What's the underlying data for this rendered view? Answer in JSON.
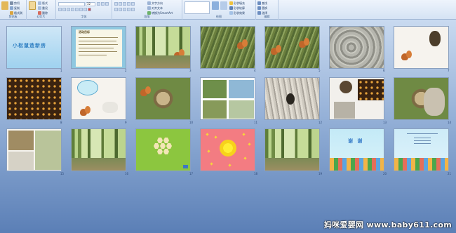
{
  "ribbon": {
    "groups": [
      {
        "id": "clipboard",
        "label": "剪贴板",
        "buttons": [
          "剪切",
          "复制",
          "格式刷"
        ],
        "paste": "粘贴"
      },
      {
        "id": "slides",
        "label": "幻灯片",
        "buttons": [
          "新建",
          "版式",
          "重设",
          "删除"
        ]
      },
      {
        "id": "font",
        "label": "字体",
        "font_size": "32"
      },
      {
        "id": "paragraph",
        "label": "段落",
        "buttons": [
          "文字方向",
          "对齐文本",
          "转换为SmartArt"
        ]
      },
      {
        "id": "drawing",
        "label": "绘图",
        "buttons": [
          "形状填充",
          "形状轮廓",
          "形状效果",
          "排列",
          "快速样式"
        ]
      },
      {
        "id": "editing",
        "label": "编辑",
        "buttons": [
          "查找",
          "替换",
          "选择"
        ]
      }
    ]
  },
  "slides": [
    {
      "n": "1",
      "kind": "title",
      "title": "小松鼠造新房"
    },
    {
      "n": "2",
      "kind": "objectives",
      "heading": "活动目标"
    },
    {
      "n": "3",
      "kind": "forest"
    },
    {
      "n": "4",
      "kind": "squirrel-tree"
    },
    {
      "n": "5",
      "kind": "squirrels-grass"
    },
    {
      "n": "6",
      "kind": "stone-faces"
    },
    {
      "n": "7",
      "kind": "squirrel-nest"
    },
    {
      "n": "8",
      "kind": "honeycomb"
    },
    {
      "n": "9",
      "kind": "animals-bubble"
    },
    {
      "n": "10",
      "kind": "squirrel-branch"
    },
    {
      "n": "11",
      "kind": "bird-collage"
    },
    {
      "n": "12",
      "kind": "bark-hole"
    },
    {
      "n": "13",
      "kind": "stone-collage"
    },
    {
      "n": "14",
      "kind": "tree-hollow"
    },
    {
      "n": "15",
      "kind": "bird-nest-collage"
    },
    {
      "n": "16",
      "kind": "forest"
    },
    {
      "n": "17",
      "kind": "hex-puzzle"
    },
    {
      "n": "18",
      "kind": "flower-pattern"
    },
    {
      "n": "19",
      "kind": "forest"
    },
    {
      "n": "20",
      "kind": "thanks",
      "title": "谢 谢"
    },
    {
      "n": "21",
      "kind": "kids-end"
    }
  ],
  "watermark": "妈咪爱婴网 www.baby611.com",
  "colors": {
    "sorter_top": "#c9daf0",
    "sorter_bottom": "#5b7fb6",
    "ribbon": "#d5e3f4"
  }
}
